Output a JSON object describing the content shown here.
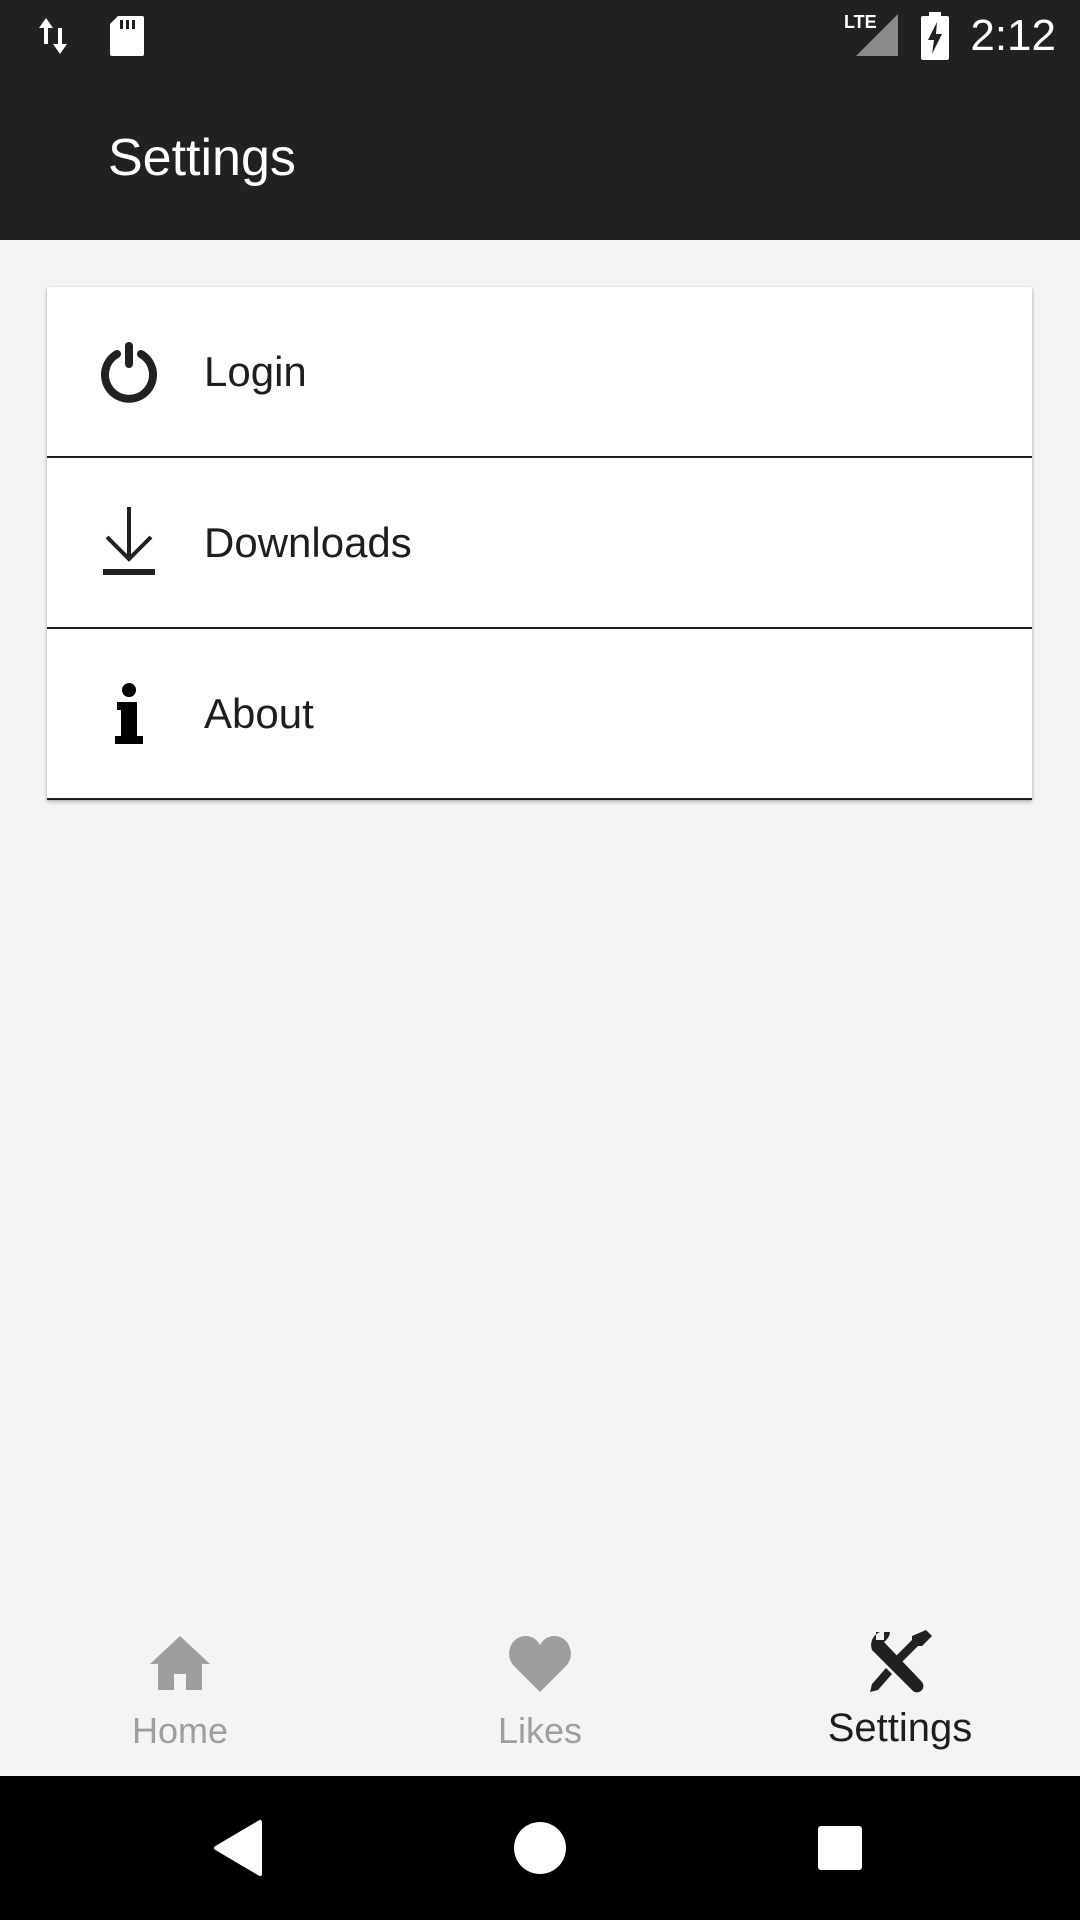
{
  "status_bar": {
    "time": "2:12",
    "network_label": "LTE",
    "icons": [
      "data-transfer-icon",
      "sd-card-icon",
      "signal-icon",
      "battery-charging-icon"
    ]
  },
  "app_bar": {
    "title": "Settings"
  },
  "menu": {
    "items": [
      {
        "label": "Login",
        "icon": "power-icon"
      },
      {
        "label": "Downloads",
        "icon": "download-icon"
      },
      {
        "label": "About",
        "icon": "info-icon"
      }
    ]
  },
  "bottom_nav": {
    "tabs": [
      {
        "label": "Home",
        "icon": "home-icon",
        "active": false
      },
      {
        "label": "Likes",
        "icon": "heart-icon",
        "active": false
      },
      {
        "label": "Settings",
        "icon": "tools-icon",
        "active": true
      }
    ]
  },
  "system_nav": {
    "buttons": [
      "back-icon",
      "home-circle-icon",
      "recents-icon"
    ]
  },
  "colors": {
    "app_bar": "#212121",
    "background": "#f4f4f4",
    "text_primary": "#1e1e1e",
    "text_inactive": "#9e9e9e"
  }
}
